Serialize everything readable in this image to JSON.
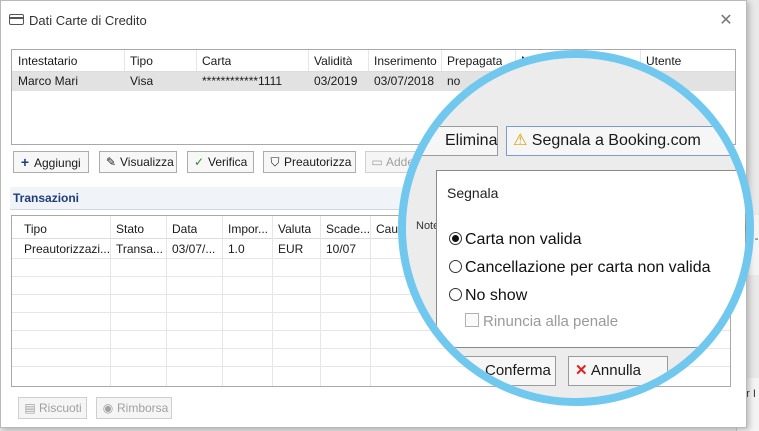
{
  "window": {
    "title": "Dati Carte di Credito",
    "close_glyph": "✕"
  },
  "cards_table": {
    "columns": [
      "Intestatario",
      "Tipo",
      "Carta",
      "Validità",
      "Inserimento",
      "Prepagata",
      "Note",
      "Utente"
    ],
    "rows": [
      {
        "intestatario": "Marco Mari",
        "tipo": "Visa",
        "carta": "************1111",
        "validita": "03/2019",
        "inserimento": "03/07/2018",
        "prepagata": "no",
        "note": "",
        "utente": ""
      }
    ]
  },
  "card_buttons": {
    "aggiungi": {
      "label": "Aggiungi",
      "icon": "plus-icon"
    },
    "visualizza": {
      "label": "Visualizza",
      "icon": "pencil-icon"
    },
    "verifica": {
      "label": "Verifica",
      "icon": "check-icon"
    },
    "preautorizza": {
      "label": "Preautorizza",
      "icon": "shield-icon"
    },
    "addebita": {
      "label": "Addeb",
      "icon": "card-icon"
    }
  },
  "transactions": {
    "section_title": "Transazioni",
    "columns": [
      "Tipo",
      "Stato",
      "Data",
      "Impor...",
      "Valuta",
      "Scade...",
      "Caus"
    ],
    "rows": [
      {
        "tipo": "Preautorizzazi...",
        "stato": "Transa...",
        "data": "03/07/...",
        "importo": "1.0",
        "valuta": "EUR",
        "scadenza": "10/07",
        "causale": ""
      }
    ]
  },
  "bottom_buttons": {
    "riscuoti": {
      "label": "Riscuoti",
      "icon": "receipt-icon"
    },
    "rimborsa": {
      "label": "Rimborsa",
      "icon": "coin-icon"
    }
  },
  "background": {
    "paren_fragment": "( -",
    "er_fragment": "er I"
  },
  "magnifier": {
    "elimina_fragment": "Elimina",
    "segnala_booking_label": "Segnala a Booking.com",
    "popup_title": "Segnala",
    "options": [
      {
        "label": "Carta non valida",
        "checked": true
      },
      {
        "label": "Cancellazione per carta non valida",
        "checked": false
      },
      {
        "label": "No show",
        "checked": false
      }
    ],
    "rinuncia_label": "Rinuncia alla penale",
    "conferma_fragment": "Conferma",
    "annulla_label": "Annulla",
    "note_fragment": "Note"
  },
  "colors": {
    "magnifier_ring": "#71c8ef",
    "section_title": "#1f3d7a",
    "selected_row": "#e2e2e2"
  }
}
